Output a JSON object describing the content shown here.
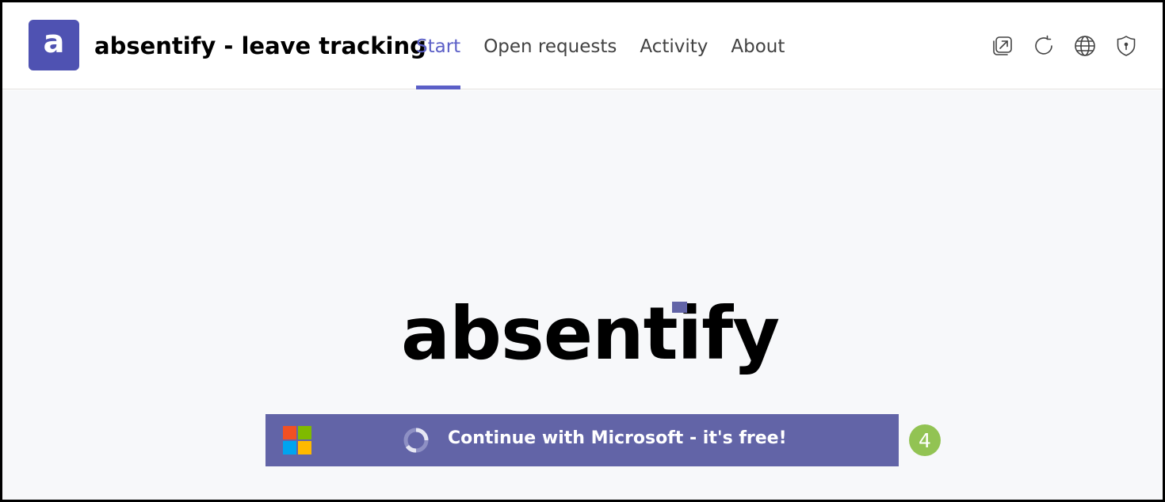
{
  "header": {
    "app_icon_letter": "a",
    "app_title": "absentify - leave tracking",
    "tabs": [
      {
        "label": "Start",
        "active": true
      },
      {
        "label": "Open requests",
        "active": false
      },
      {
        "label": "Activity",
        "active": false
      },
      {
        "label": "About",
        "active": false
      }
    ],
    "icons": [
      "popout-icon",
      "refresh-icon",
      "globe-icon",
      "shield-icon"
    ]
  },
  "main": {
    "logo_text": "absentify",
    "signin_button": {
      "label": "Continue with Microsoft - it's free!",
      "icon": "microsoft-logo-icon",
      "loading": true
    },
    "step_badge": "4"
  },
  "colors": {
    "accent": "#5b5fc7",
    "app_icon_bg": "#4f52b2",
    "button_bg": "#6264a7",
    "badge_bg": "#92c353",
    "content_bg": "#f7f8fa"
  }
}
